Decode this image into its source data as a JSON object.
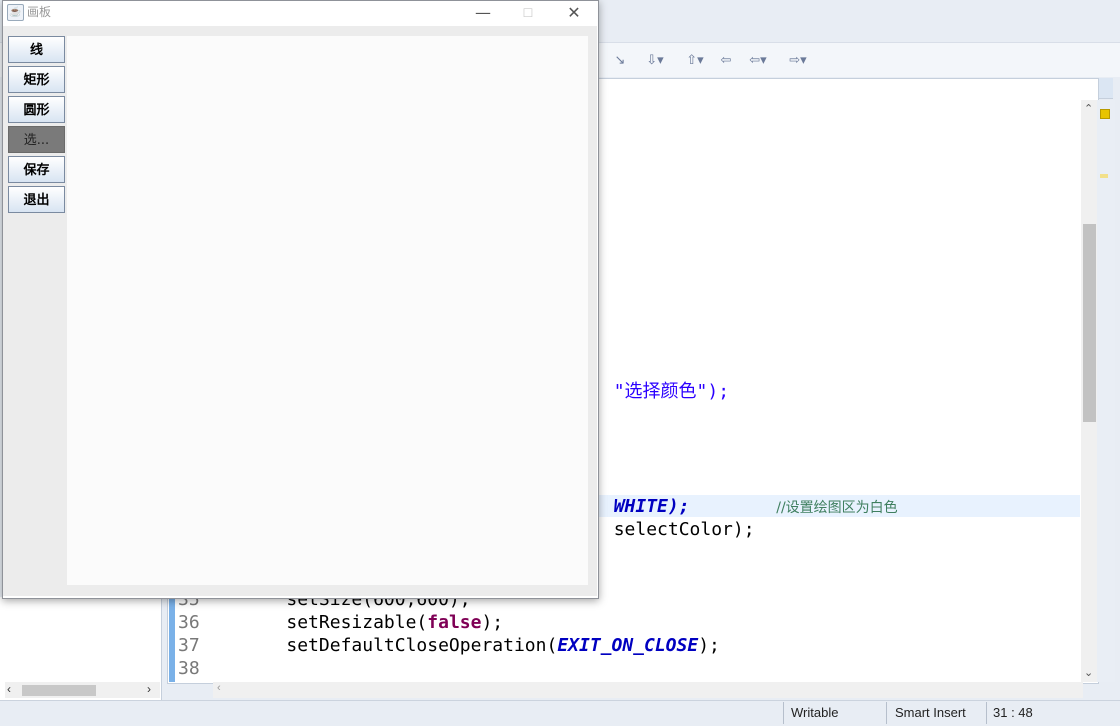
{
  "ide": {
    "toolbar_glyphs": [
      "↘",
      "⇩▾",
      "⇧▾",
      "⇦",
      "⇦▾",
      "⇨▾"
    ],
    "code_lines": [
      {
        "segments": [
          {
            "t": "\"选择颜色\");",
            "cls": "code"
          }
        ]
      },
      {
        "segments": [
          {
            "t": "WHITE);",
            "cls": "const"
          },
          {
            "t": "        ",
            "cls": "code"
          },
          {
            "t": "//设置绘图区为白色",
            "cls": "cmt"
          }
        ]
      },
      {
        "segments": [
          {
            "t": "selectColor);",
            "cls": "code"
          }
        ]
      }
    ],
    "numbered_lines": [
      {
        "num": "35",
        "code": "        setSize(600,600);"
      },
      {
        "num": "36",
        "code": "        setResizable(",
        "kw": "false",
        "after": ");"
      },
      {
        "num": "37",
        "code": "        setDefaultCloseOperation(",
        "const": "EXIT_ON_CLOSE",
        "after": ");"
      },
      {
        "num": "38",
        "code": ""
      }
    ],
    "status": {
      "writable": "Writable",
      "insert_mode": "Smart Insert",
      "position": "31 : 48"
    }
  },
  "window": {
    "title": "画板",
    "minimize": "—",
    "maximize": "☐",
    "close": "✕"
  },
  "tools": [
    {
      "label": "线",
      "pressed": false
    },
    {
      "label": "矩形",
      "pressed": false
    },
    {
      "label": "圆形",
      "pressed": false
    },
    {
      "label": "选...",
      "pressed": true
    },
    {
      "label": "保存",
      "pressed": false
    },
    {
      "label": "退出",
      "pressed": false
    }
  ]
}
